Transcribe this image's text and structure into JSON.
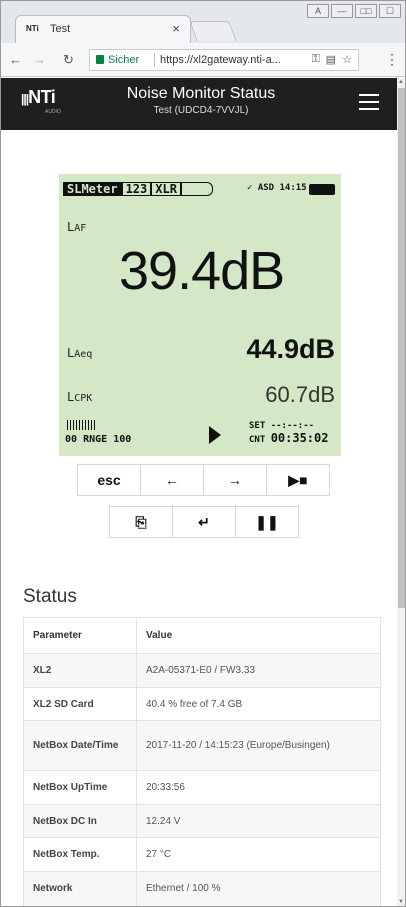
{
  "browser": {
    "tab_title": "Test",
    "tab_favicon": "NTi",
    "tab_close": "×",
    "secure_label": "Sicher",
    "url": "https://xl2gateway.nti-a...",
    "window_buttons": [
      "A",
      "—",
      "□□",
      "☐"
    ]
  },
  "header": {
    "logo": "NTi",
    "logo_sub": "AUDIO",
    "title": "Noise Monitor Status",
    "subtitle": "Test (UDCD4-7VVJL)"
  },
  "lcd": {
    "top_tabs": [
      "SLMeter",
      "123",
      "XLR"
    ],
    "status": "✓ ASD 14:15",
    "main_label": "AF",
    "main_value": "39.4dB",
    "leq_label": "Aeq",
    "leq_value": "44.9dB",
    "cpk_label": "CPK",
    "cpk_value": "60.7dB",
    "range_label": "RNGE",
    "range_lo": "00",
    "range_hi": "100",
    "set_label": "SET",
    "set_value": "--:--:--",
    "cnt_label": "CNT",
    "cnt_value": "00:35:02"
  },
  "keypad": {
    "row1": [
      "esc",
      "←",
      "→",
      "▶■"
    ],
    "row2": [
      "⎘",
      "↵",
      "❚❚"
    ]
  },
  "status": {
    "heading": "Status",
    "columns": [
      "Parameter",
      "Value"
    ],
    "rows": [
      {
        "param": "XL2",
        "value": "A2A-05371-E0 / FW3.33"
      },
      {
        "param": "XL2 SD Card",
        "value": "40.4 % free of 7.4 GB"
      },
      {
        "param": "NetBox Date/Time",
        "value": "2017-11-20 / 14:15:23 (Europe/Busingen)"
      },
      {
        "param": "NetBox UpTime",
        "value": "20:33:56"
      },
      {
        "param": "NetBox DC In",
        "value": "12.24 V"
      },
      {
        "param": "NetBox Temp.",
        "value": "27 °C"
      },
      {
        "param": "Network",
        "value": "Ethernet / 100 %"
      }
    ]
  }
}
